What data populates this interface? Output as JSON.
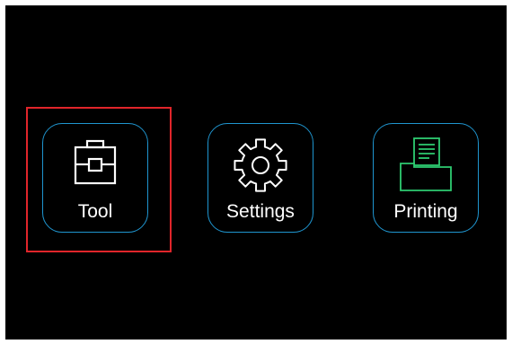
{
  "menu": {
    "items": [
      {
        "label": "Tool",
        "icon": "toolbox-icon",
        "icon_color": "#ffffff",
        "selected": true
      },
      {
        "label": "Settings",
        "icon": "gear-icon",
        "icon_color": "#ffffff",
        "selected": false
      },
      {
        "label": "Printing",
        "icon": "printer-icon",
        "icon_color": "#2ecc71",
        "selected": false
      }
    ]
  },
  "colors": {
    "background": "#000000",
    "tile_border": "#1f95cf",
    "selection": "#e0252a",
    "text": "#ffffff"
  }
}
